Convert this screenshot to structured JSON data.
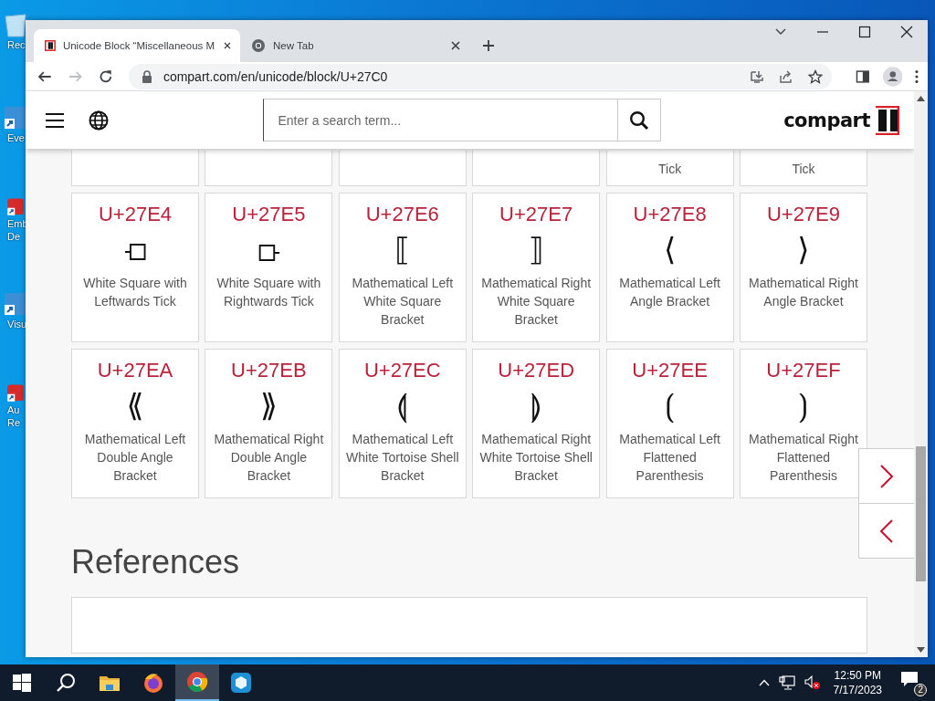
{
  "desktop_icons": [
    {
      "kind": "bin",
      "lines": [
        "Rec"
      ]
    },
    {
      "kind": "shortcut",
      "lines": [
        "Eve"
      ]
    },
    {
      "kind": "app",
      "lines": [
        "Emb",
        "De"
      ]
    },
    {
      "kind": "shortcut",
      "lines": [
        "Visu"
      ]
    },
    {
      "kind": "app",
      "lines": [
        "Au",
        "Re"
      ]
    }
  ],
  "browser": {
    "tabs": [
      {
        "title": "Unicode Block “Miscellaneous M",
        "kind": "site",
        "selected": true
      },
      {
        "title": "New Tab",
        "kind": "newtab",
        "selected": false
      }
    ],
    "nav_buttons": [
      {
        "kind": "back",
        "disabled": false
      },
      {
        "kind": "forward",
        "disabled": true
      },
      {
        "kind": "reload",
        "disabled": false
      }
    ],
    "address": "compart.com/en/unicode/block/U+27C0"
  },
  "page": {
    "search": {
      "placeholder": "Enter a search term..."
    },
    "logo": "compart",
    "partial_row": [
      {
        "kind": "blank"
      },
      {
        "kind": "blank"
      },
      {
        "kind": "blank"
      },
      {
        "kind": "blank"
      },
      {
        "kind": "text",
        "text": "Tick"
      },
      {
        "kind": "text",
        "text": "Tick"
      }
    ],
    "characters": [
      {
        "code": "U+27E4",
        "glyph": "⟤",
        "name": "White Square with Leftwards Tick"
      },
      {
        "code": "U+27E5",
        "glyph": "⟥",
        "name": "White Square with Rightwards Tick"
      },
      {
        "code": "U+27E6",
        "glyph": "⟦",
        "name": "Mathematical Left White Square Bracket"
      },
      {
        "code": "U+27E7",
        "glyph": "⟧",
        "name": "Mathematical Right White Square Bracket"
      },
      {
        "code": "U+27E8",
        "glyph": "⟨",
        "name": "Mathematical Left Angle Bracket"
      },
      {
        "code": "U+27E9",
        "glyph": "⟩",
        "name": "Mathematical Right Angle Bracket"
      },
      {
        "code": "U+27EA",
        "glyph": "⟪",
        "name": "Mathematical Left Double Angle Bracket"
      },
      {
        "code": "U+27EB",
        "glyph": "⟫",
        "name": "Mathematical Right Double Angle Bracket"
      },
      {
        "code": "U+27EC",
        "glyph": "⟬",
        "name": "Mathematical Left White Tortoise Shell Bracket"
      },
      {
        "code": "U+27ED",
        "glyph": "⟭",
        "name": "Mathematical Right White Tortoise Shell Bracket"
      },
      {
        "code": "U+27EE",
        "glyph": "⟮",
        "name": "Mathematical Left Flattened Parenthesis"
      },
      {
        "code": "U+27EF",
        "glyph": "⟯",
        "name": "Mathematical Right Flattened Parenthesis"
      }
    ],
    "references_heading": "References"
  },
  "taskbar": {
    "items": [
      {
        "kind": "start",
        "selected": false
      },
      {
        "kind": "search",
        "selected": false
      },
      {
        "kind": "folder",
        "selected": false
      },
      {
        "kind": "firefox",
        "selected": false
      },
      {
        "kind": "chrome",
        "selected": true
      },
      {
        "kind": "cube",
        "selected": false
      }
    ],
    "time": "12:50 PM",
    "date": "7/17/2023",
    "notifications": "2"
  }
}
